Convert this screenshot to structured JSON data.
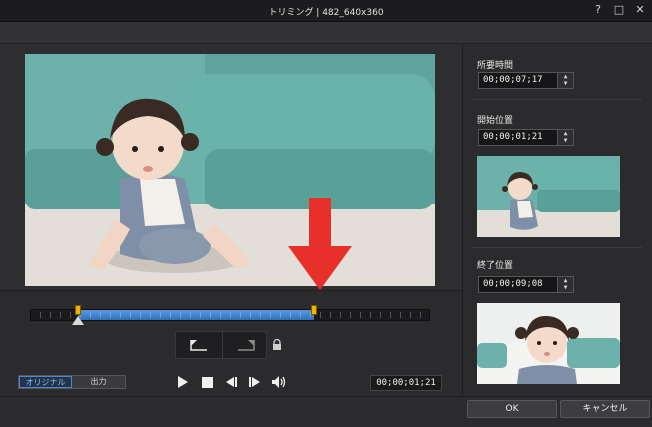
{
  "window": {
    "title": "トリミング | 482_640x360",
    "help_glyph": "?",
    "maximize_glyph": "□",
    "close_glyph": "✕"
  },
  "timeline": {
    "in_point": 0.12,
    "out_point": 0.71,
    "playhead": 0.12
  },
  "bottom": {
    "toggle_original": "オリジナル",
    "toggle_output": "出力",
    "selected_toggle": "オリジナル",
    "current_time": "00;00;01;21"
  },
  "right_panel": {
    "duration_label": "所要時間",
    "duration_value": "00;00;07;17",
    "start_label": "開始位置",
    "start_value": "00;00;01;21",
    "end_label": "終了位置",
    "end_value": "00;00;09;08"
  },
  "footer": {
    "ok_label": "OK",
    "cancel_label": "キャンセル"
  },
  "colors": {
    "selection_blue": "#3a7fcf",
    "marker_yellow": "#f0b400",
    "arrow_red": "#e8302a",
    "wall_teal": "#6fb4ad"
  }
}
